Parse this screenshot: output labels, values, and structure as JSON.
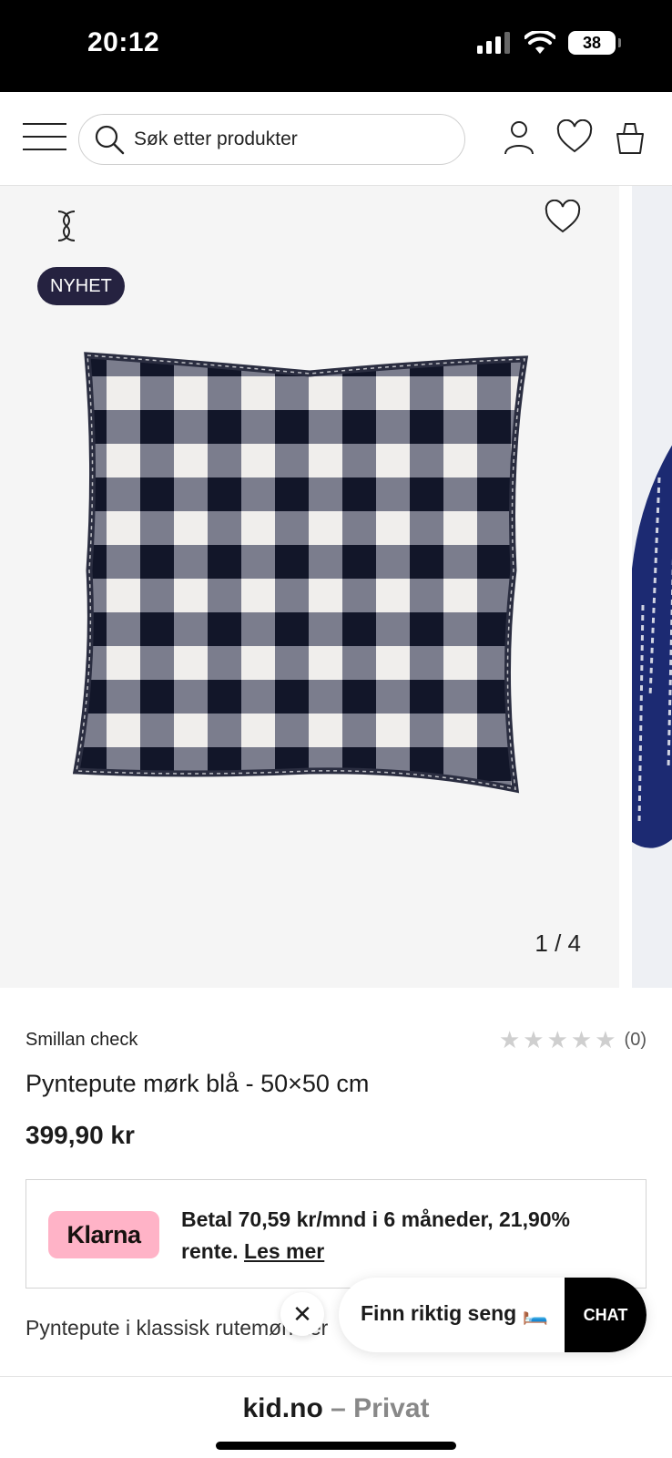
{
  "status": {
    "time": "20:12",
    "battery": "38"
  },
  "header": {
    "search_placeholder": "Søk etter produkter"
  },
  "gallery": {
    "badge": "NYHET",
    "pager": "1 / 4"
  },
  "product": {
    "brand": "Smillan check",
    "rating_count": "(0)",
    "rating_value": 0,
    "title": "Pyntepute mørk blå - 50×50 cm",
    "price": "399,90 kr",
    "description": "Pyntepute i klassisk rutemønster"
  },
  "klarna": {
    "logo": "Klarna",
    "text": "Betal 70,59 kr/mnd i 6 måneder, 21,90% rente.",
    "link": "Les mer"
  },
  "chat": {
    "prompt": "Finn riktig seng 🛏️",
    "button": "CHAT",
    "close": "✕"
  },
  "browser": {
    "domain": "kid.no",
    "separator": " – ",
    "mode": "Privat"
  },
  "colors": {
    "badge_bg": "#252240",
    "klarna_pink": "#ffb3c7",
    "navy": "#1c2140"
  },
  "icons": [
    "menu-icon",
    "search-icon",
    "user-icon",
    "heart-icon",
    "bag-icon",
    "brand-logo-icon",
    "wishlist-heart-icon",
    "star-icon",
    "close-icon"
  ]
}
